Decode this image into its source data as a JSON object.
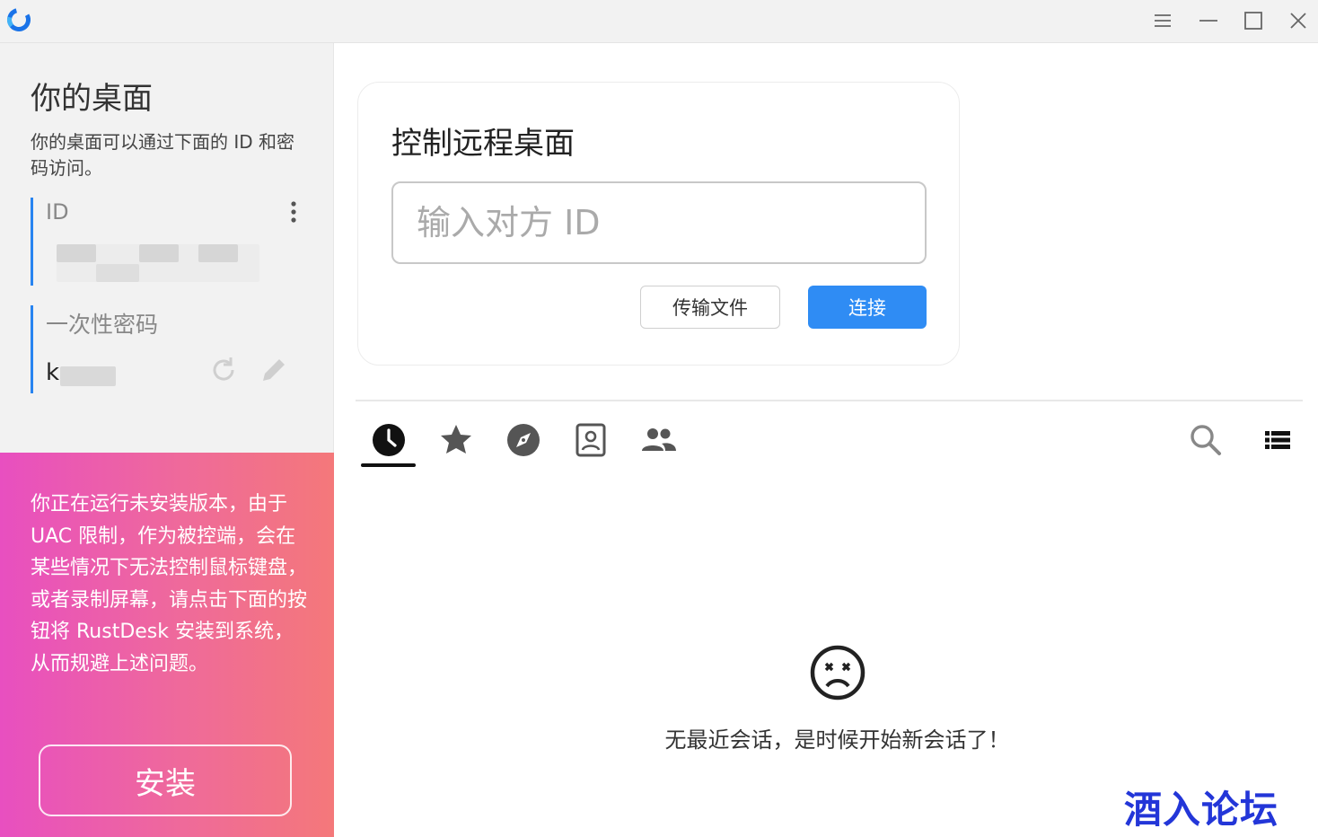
{
  "window": {
    "controls": [
      "menu-icon",
      "minimize-icon",
      "maximize-icon",
      "close-icon"
    ]
  },
  "left_panel": {
    "title": "你的桌面",
    "description": "你的桌面可以通过下面的 ID 和密码访问。",
    "id_label": "ID",
    "password_label": "一次性密码",
    "password_visible_prefix": "k"
  },
  "warning": {
    "text": "你正在运行未安装版本，由于 UAC 限制，作为被控端，会在某些情况下无法控制鼠标键盘，或者录制屏幕，请点击下面的按钮将 RustDesk 安装到系统，从而规避上述问题。",
    "install_label": "安装"
  },
  "control_card": {
    "title": "控制远程桌面",
    "id_placeholder": "输入对方 ID",
    "id_value": "",
    "file_transfer_label": "传输文件",
    "connect_label": "连接"
  },
  "tabs": [
    {
      "icon": "clock-icon",
      "active": true
    },
    {
      "icon": "star-icon",
      "active": false
    },
    {
      "icon": "compass-icon",
      "active": false
    },
    {
      "icon": "address-book-icon",
      "active": false
    },
    {
      "icon": "group-icon",
      "active": false
    }
  ],
  "empty_state": {
    "icon": "sad-face-icon",
    "text": "无最近会话，是时候开始新会话了！"
  },
  "watermark": "酒入论坛",
  "colors": {
    "accent": "#2f8cf4",
    "warning_gradient_start": "#e84fc0",
    "warning_gradient_end": "#f4787a"
  }
}
